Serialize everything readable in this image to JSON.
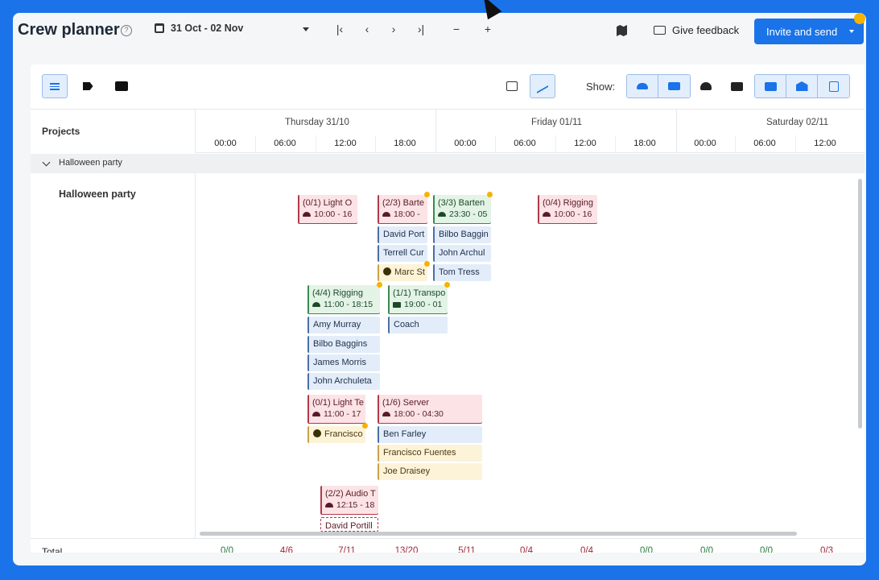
{
  "header": {
    "title": "Crew planner",
    "date_range": "31 Oct - 02 Nov",
    "feedback_label": "Give feedback",
    "invite_label": "Invite and send"
  },
  "toolbar": {
    "show_label": "Show:"
  },
  "grid": {
    "projects_header": "Projects",
    "days": [
      "Thursday 31/10",
      "Friday 01/11",
      "Saturday 02/11"
    ],
    "hours": [
      "00:00",
      "06:00",
      "12:00",
      "18:00",
      "00:00",
      "06:00",
      "12:00",
      "18:00",
      "00:00",
      "06:00",
      "12:00"
    ],
    "group": "Halloween party",
    "project": "Halloween party"
  },
  "shifts": [
    {
      "title": "(0/1) Light O",
      "time": "10:00 - 16",
      "status": "red"
    },
    {
      "title": "(2/3) Barte",
      "time": "18:00 -",
      "status": "red"
    },
    {
      "title": "(3/3) Barten",
      "time": "23:30 - 05",
      "status": "green"
    },
    {
      "title": "(0/4) Rigging",
      "time": "10:00 - 16",
      "status": "red"
    },
    {
      "title": "(4/4) Rigging",
      "time": "11:00 - 18:15",
      "status": "green"
    },
    {
      "title": "(1/1) Transpo",
      "time": "19:00 - 01",
      "status": "green"
    },
    {
      "title": "(0/1) Light Te",
      "time": "11:00 - 17",
      "status": "red"
    },
    {
      "title": "(1/6) Server",
      "time": "18:00 - 04:30",
      "status": "red"
    },
    {
      "title": "(2/2) Audio T",
      "time": "12:15 - 18",
      "status": "red"
    }
  ],
  "people": {
    "bartender_a": [
      "David Port",
      "Terrell Cur",
      "Marc St"
    ],
    "bartender_b": [
      "Bilbo Baggin",
      "John Archul",
      "Tom Tress"
    ],
    "rigging": [
      "Amy Murray",
      "Bilbo Baggins",
      "James Morris",
      "John Archuleta"
    ],
    "transport": [
      "Coach"
    ],
    "light_tech": [
      "Francisco"
    ],
    "server": [
      "Ben Farley",
      "Francisco Fuentes",
      "Joe Draisey"
    ],
    "audio": [
      "David Portill"
    ]
  },
  "totals": {
    "label": "Total",
    "values": [
      "0/0",
      "4/6",
      "7/11",
      "13/20",
      "5/11",
      "0/4",
      "0/4",
      "0/0",
      "0/0",
      "0/0",
      "0/3"
    ]
  },
  "colors": {
    "accent": "#1a73e8",
    "shift_red": "#fbe3e6",
    "shift_green": "#e3f3e6",
    "person_blue": "#e3edf9",
    "person_yellow": "#fdf3d8",
    "notification": "#f4b400"
  }
}
